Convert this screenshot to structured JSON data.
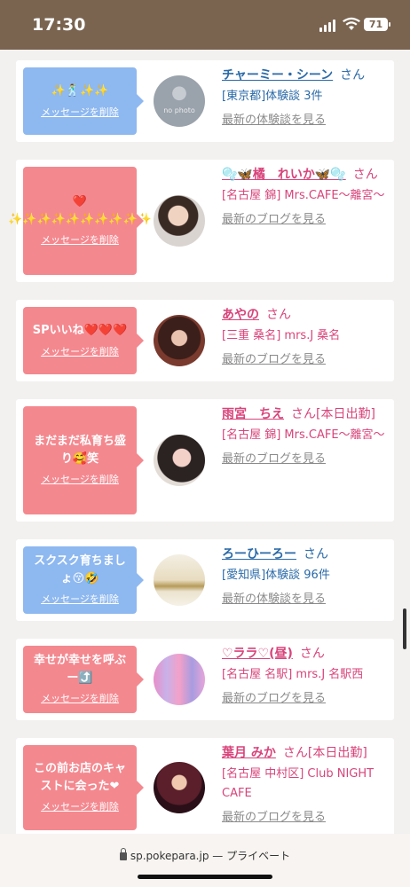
{
  "status": {
    "time": "17:30",
    "battery": "71"
  },
  "cards": [
    {
      "bubble_color": "blue",
      "message": "✨🕺✨✨",
      "delete_label": "メッセージを削除",
      "avatar_label": "no photo",
      "name": "チャーミー・シーン",
      "honorific": "さん",
      "name_suffix": "",
      "shop": "[東京都]体験談 3件",
      "link": "最新の体験談を見る",
      "theme": "blue"
    },
    {
      "bubble_color": "pink",
      "message": "❤️ ✨✨✨✨✨✨✨✨✨✨",
      "delete_label": "メッセージを削除",
      "avatar_label": "",
      "name": "🫧🦋橘　れいか🦋🫧",
      "honorific": "さん",
      "name_suffix": "",
      "shop": "[名古屋 錦] Mrs.CAFE〜離宮〜",
      "link": "最新のブログを見る",
      "theme": "pink"
    },
    {
      "bubble_color": "pink",
      "message": "SPいいね❤️❤️❤️",
      "delete_label": "メッセージを削除",
      "avatar_label": "",
      "name": "あやの",
      "honorific": "さん",
      "name_suffix": "",
      "shop": "[三重 桑名] mrs.J 桑名",
      "link": "最新のブログを見る",
      "theme": "pink"
    },
    {
      "bubble_color": "pink",
      "message": "まだまだ私育ち盛り🥰笑",
      "delete_label": "メッセージを削除",
      "avatar_label": "",
      "name": "雨宮　ちえ",
      "honorific": "さん",
      "name_suffix": "[本日出勤]",
      "shop": "[名古屋 錦] Mrs.CAFE〜離宮〜",
      "link": "最新のブログを見る",
      "theme": "pink"
    },
    {
      "bubble_color": "blue",
      "message": "スクスク育ちましょ😚🤣",
      "delete_label": "メッセージを削除",
      "avatar_label": "",
      "name": "ろーひーろー",
      "honorific": "さん",
      "name_suffix": "",
      "shop": "[愛知県]体験談 96件",
      "link": "最新の体験談を見る",
      "theme": "blue"
    },
    {
      "bubble_color": "pink",
      "message": "幸せが幸せを呼ぶー⤴️",
      "delete_label": "メッセージを削除",
      "avatar_label": "",
      "name": "♡ララ♡(昼)",
      "honorific": "さん",
      "name_suffix": "",
      "shop": "[名古屋 名駅] mrs.J 名駅西",
      "link": "最新のブログを見る",
      "theme": "pink"
    },
    {
      "bubble_color": "pink",
      "message": "この前お店のキャストに会った❤︎",
      "delete_label": "メッセージを削除",
      "avatar_label": "",
      "name": "葉月 みか",
      "honorific": "さん",
      "name_suffix": "[本日出勤]",
      "shop": "[名古屋 中村区] Club NIGHT CAFE",
      "link": "最新のブログを見る",
      "theme": "pink"
    }
  ],
  "browser": {
    "url": "sp.pokepara.jp",
    "mode": "— プライベート"
  }
}
